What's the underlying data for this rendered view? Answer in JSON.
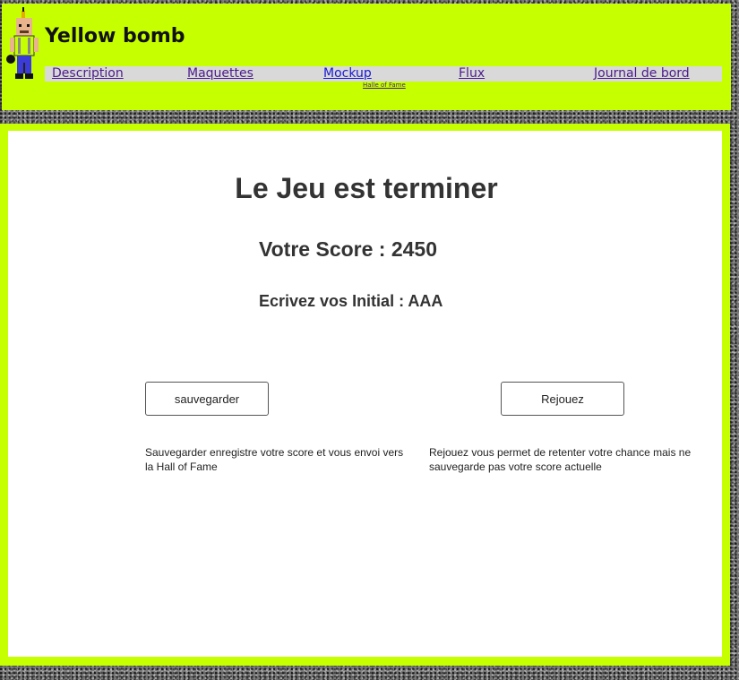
{
  "header": {
    "site_title": "Yellow bomb",
    "mascot": "bomber-character-icon",
    "nav": [
      {
        "label": "Description"
      },
      {
        "label": "Maquettes"
      },
      {
        "label": "Mockup"
      },
      {
        "label": "Flux"
      },
      {
        "label": "Journal de bord"
      }
    ],
    "sub_link": "Halle of Fame"
  },
  "main": {
    "title": "Le Jeu est terminer",
    "score_text": "Votre Score : 2450",
    "initials_text": "Ecrivez vos Initial : AAA",
    "save_button": "sauvegarder",
    "replay_button": "Rejouez",
    "save_description": "Sauvegarder enregistre votre score et vous envoi vers la Hall of Fame",
    "replay_description": "Rejouez vous permet de retenter votre chance mais ne sauvegarde pas votre score actuelle"
  },
  "colors": {
    "accent": "#c6ff00",
    "nav_bar": "#d9d9d9",
    "link": "#4b1b8c",
    "link_active": "#1a1ad4",
    "text": "#333333"
  }
}
